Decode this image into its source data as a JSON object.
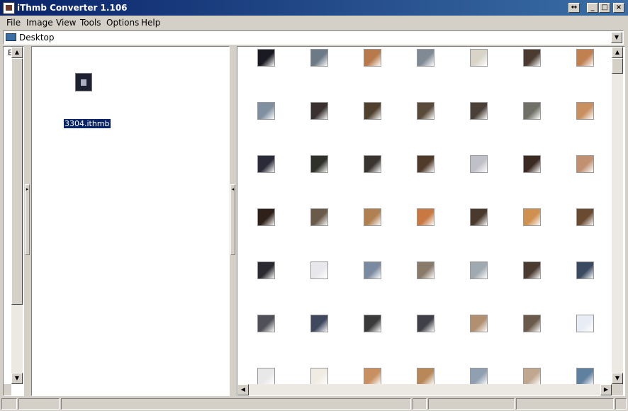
{
  "window": {
    "title": "iThmb Converter 1.106",
    "buttons": {
      "restore": "↔",
      "minimize": "_",
      "maximize": "□",
      "close": "×"
    }
  },
  "menu": [
    "File",
    "Image",
    "View",
    "Tools",
    "Options",
    "Help"
  ],
  "address": {
    "value": "Desktop",
    "icon": "desktop-icon"
  },
  "tree": {
    "visible_char": "E"
  },
  "file_list": {
    "items": [
      {
        "name": "3304.ithmb",
        "selected": true
      }
    ]
  },
  "thumbnails": {
    "columns": 7,
    "rows": 7,
    "colors": [
      [
        "#1a1a22",
        "#6b7a86",
        "#b87a4a",
        "#7f8a95",
        "#d8d4c8",
        "#4a3a30",
        "#c08050"
      ],
      [
        "#8090a0",
        "#3a3030",
        "#50402e",
        "#5a4a3a",
        "#4a4038",
        "#707068",
        "#c89060"
      ],
      [
        "#2a2a38",
        "#30302a",
        "#3a3430",
        "#503a2a",
        "#c0c0c8",
        "#3a2a22",
        "#c09070"
      ],
      [
        "#30201a",
        "#6a5a4a",
        "#b08050",
        "#c87840",
        "#4a3a2e",
        "#d09050",
        "#6a4a30"
      ],
      [
        "#2a2a30",
        "#e8e8ec",
        "#7a8aa0",
        "#8a7a6a",
        "#a0a8b0",
        "#4a3a30",
        "#3a4a60"
      ],
      [
        "#505058",
        "#404860",
        "#3a3a3a",
        "#404048",
        "#b09070",
        "#6a5a4a",
        "#e8ecf4"
      ],
      [
        "#e8e8e8",
        "#f0ece4",
        "#c89060",
        "#b88858",
        "#90a0b0",
        "#c0a890",
        "#6080a0"
      ]
    ]
  }
}
